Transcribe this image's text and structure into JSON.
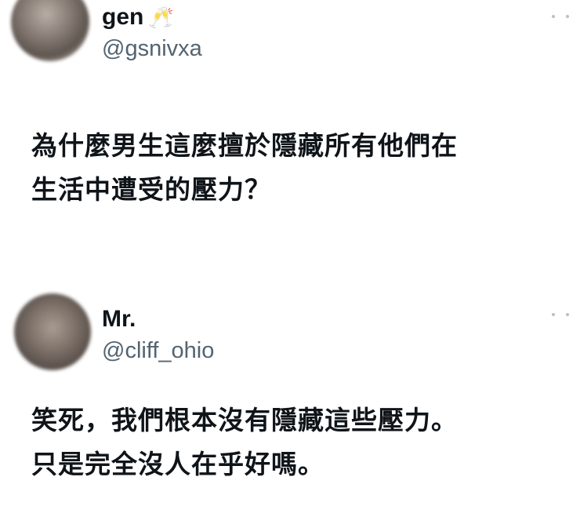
{
  "tweets": [
    {
      "name": "gen",
      "name_emoji": "🥂",
      "handle": "@gsnivxa",
      "lines": [
        "為什麼男生這麼擅於隱藏所有他們在",
        "生活中遭受的壓力？"
      ],
      "more_icon": "more-dots-icon"
    },
    {
      "name": "Mr.",
      "handle": "@cliff_ohio",
      "lines": [
        "笑死，我們根本沒有隱藏這些壓力。",
        "只是完全沒人在乎好嗎。"
      ],
      "more_icon": "more-dots-icon"
    }
  ]
}
